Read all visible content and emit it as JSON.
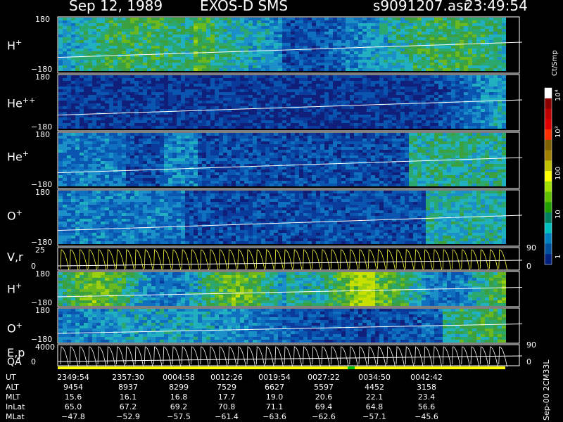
{
  "header": {
    "date": "Sep 12, 1989",
    "instrument": "EXOS-D SMS",
    "file": "s9091207.asr",
    "time": "23:49:54"
  },
  "panels": [
    {
      "id": "h-plus",
      "label": "H",
      "sup": "+",
      "ymax": "180",
      "ymin": "−180"
    },
    {
      "id": "he-pp",
      "label": "He",
      "sup": "++",
      "ymax": "180",
      "ymin": "−180"
    },
    {
      "id": "he-plus",
      "label": "He",
      "sup": "+",
      "ymax": "180",
      "ymin": "−180"
    },
    {
      "id": "o-plus",
      "label": "O",
      "sup": "+",
      "ymax": "180",
      "ymin": "−180"
    },
    {
      "id": "vr",
      "label": "V,r",
      "sup": "",
      "ymax": "25",
      "ymin": "0",
      "rmax": "90",
      "rmin": "0"
    },
    {
      "id": "h-plus-2",
      "label": "H",
      "sup": "+",
      "ymax": "180",
      "ymin": "−180"
    },
    {
      "id": "o-plus-2",
      "label": "O",
      "sup": "+",
      "ymax": "180",
      "ymin": "−180"
    },
    {
      "id": "ep",
      "label": "E,p",
      "sup": "",
      "ymax": "4000",
      "ymin": "0",
      "rmax": "90",
      "rmin": "0"
    }
  ],
  "qa_label": "QA",
  "colorbar": {
    "unit": "Ct/Smp",
    "ticks": [
      "10⁴",
      "10³",
      "100",
      "10",
      "1"
    ],
    "colors": [
      "#ffffff",
      "#8b0000",
      "#c00000",
      "#e00000",
      "#ff3000",
      "#806000",
      "#a08000",
      "#c0c000",
      "#ffff00",
      "#a0e000",
      "#60c000",
      "#20a000",
      "#008060",
      "#00c0c0",
      "#0080c0",
      "#0050a0",
      "#002080"
    ]
  },
  "side_note": "Sep-00 2CM33L",
  "table": {
    "rows": [
      {
        "label": "UT",
        "values": [
          "2349:54",
          "2357:30",
          "0004:58",
          "0012:26",
          "0019:54",
          "0027:22",
          "0034:50",
          "0042:42"
        ]
      },
      {
        "label": "ALT",
        "values": [
          "9454",
          "8937",
          "8299",
          "7529",
          "6627",
          "5597",
          "4452",
          "3158"
        ]
      },
      {
        "label": "MLT",
        "values": [
          "15.6",
          "16.1",
          "16.8",
          "17.7",
          "19.0",
          "20.6",
          "22.1",
          "23.4"
        ]
      },
      {
        "label": "InLat",
        "values": [
          "65.0",
          "67.2",
          "69.2",
          "70.8",
          "71.1",
          "69.4",
          "64.8",
          "56.6"
        ]
      },
      {
        "label": "MLat",
        "values": [
          "−47.8",
          "−52.9",
          "−57.5",
          "−61.4",
          "−63.6",
          "−62.6",
          "−57.1",
          "−45.6"
        ]
      }
    ]
  },
  "chart_data": {
    "type": "heatmap",
    "title": "Sep 12, 1989 EXOS-D SMS",
    "x": [
      "2349:54",
      "2357:30",
      "0004:58",
      "0012:26",
      "0019:54",
      "0027:22",
      "0034:50",
      "0042:42"
    ],
    "xlabel": "UT",
    "colorbar_label": "Ct/Smp",
    "colorbar_range": [
      1,
      10000
    ],
    "colorbar_scale": "log",
    "series": [
      {
        "name": "H+",
        "ylim": [
          -180,
          180
        ]
      },
      {
        "name": "He++",
        "ylim": [
          -180,
          180
        ]
      },
      {
        "name": "He+",
        "ylim": [
          -180,
          180
        ]
      },
      {
        "name": "O+",
        "ylim": [
          -180,
          180
        ]
      },
      {
        "name": "V,r",
        "ylim": [
          0,
          25
        ]
      },
      {
        "name": "H+",
        "ylim": [
          -180,
          180
        ]
      },
      {
        "name": "O+",
        "ylim": [
          -180,
          180
        ]
      },
      {
        "name": "E,p",
        "ylim": [
          0,
          4000
        ]
      }
    ]
  }
}
